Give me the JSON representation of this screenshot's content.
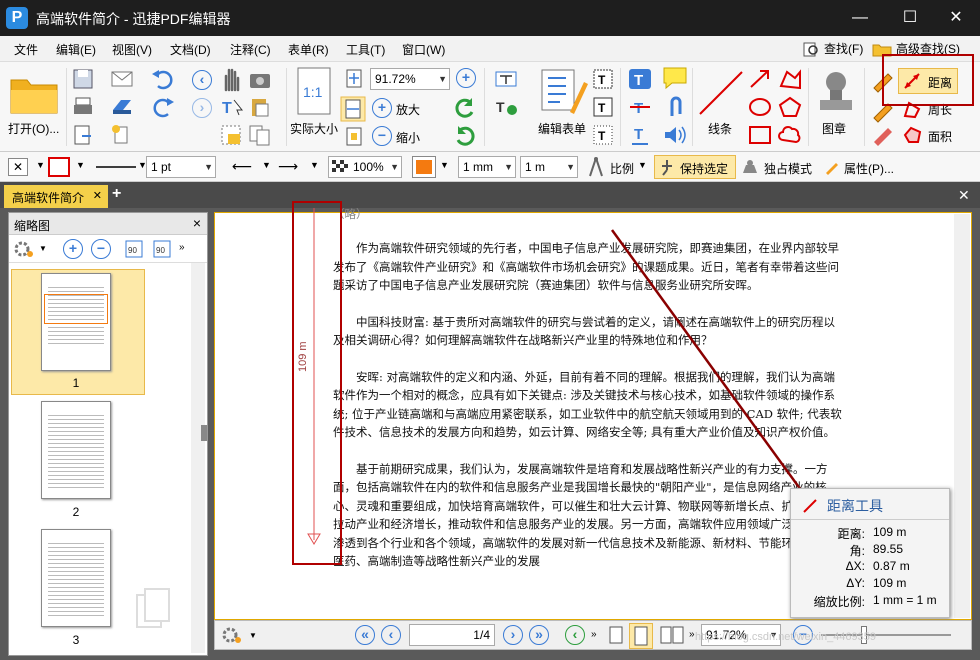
{
  "window": {
    "title": "高端软件简介 - 迅捷PDF编辑器",
    "app_icon": "P",
    "min": "—",
    "max": "☐",
    "close": "✕"
  },
  "menu": {
    "items": [
      "文件",
      "编辑(E)",
      "视图(V)",
      "文档(D)",
      "注释(C)",
      "表单(R)",
      "工具(T)",
      "窗口(W)"
    ],
    "find": "查找(F)",
    "adv_find": "高级查找(S)"
  },
  "ribbon": {
    "open": "打开(O)...",
    "zoom": "91.72%",
    "zoom_in": "放大",
    "zoom_out": "缩小",
    "actual_size": "实际大小",
    "actual_icon": "1:1",
    "edit_form": "编辑表单",
    "lines": "线条",
    "stamp": "图章",
    "distance": "距离",
    "perimeter": "周长",
    "area": "面积",
    "text_t": "T"
  },
  "props": {
    "line_width": "1 pt",
    "opacity": "100%",
    "w1": "1 mm",
    "w2": "1 m",
    "scale": "比例",
    "keep_selected": "保持选定",
    "exclusive": "独占模式",
    "properties": "属性(P)..."
  },
  "tabs": {
    "doc": "高端软件简介",
    "add": "+",
    "close": "✕"
  },
  "thumbs": {
    "title": "缩略图",
    "close": "×",
    "pages": [
      "1",
      "2",
      "3"
    ],
    "rot_l": "90",
    "rot_r": "90"
  },
  "doc": {
    "top_fragment": "（略）",
    "paragraphs": [
      "作为高端软件研究领域的先行者，中国电子信息产业发展研究院，即赛迪集团，在业界内部较早发布了《高端软件产业研究》和《高端软件市场机会研究》的课题成果。近日，笔者有幸带着这些问题采访了中国电子信息产业发展研究院（赛迪集团）软件与信息服务业研究所安晖。",
      "中国科技财富: 基于贵所对高端软件的研究与尝试着的定义，请阐述在高端软件上的研究历程以及相关调研心得？如何理解高端软件在战略新兴产业里的特殊地位和作用？",
      "安晖: 对高端软件的定义和内涵、外延，目前有着不同的理解。根据我们的理解，我们认为高端软件作为一个相对的概念，应具有如下关键点: 涉及关键技术与核心技术，如基础软件领域的操作系统; 位于产业链高端和与高端应用紧密联系，如工业软件中的航空航天领域用到的 CAD 软件; 代表软件技术、信息技术的发展方向和趋势，如云计算、网络安全等; 具有重大产业价值及知识产权价值。",
      "基于前期研究成果，我们认为，发展高端软件是培育和发展战略性新兴产业的有力支撑。一方面，包括高端软件在内的软件和信息服务产业是我国增长最快的\"朝阳产业\"，是信息网络产业的核心、灵魂和重要组成，加快培育高端软件，可以催生和壮大云计算、物联网等新增长点、扩大内需、拉动产业和经济增长，推动软件和信息服务产业的发展。另一方面，高端软件应用领域广泛，已深入渗透到各个行业和各个领域，高端软件的发展对新一代信息技术及新能源、新材料、节能环保、生物医药、高端制造等战略性新兴产业的发展"
    ],
    "measure_label": "109 m"
  },
  "tooltip": {
    "title": "距离工具",
    "rows": [
      [
        "距离:",
        "109 m"
      ],
      [
        "角:",
        "89.55"
      ],
      [
        "ΔX:",
        "0.87 m"
      ],
      [
        "ΔY:",
        "109 m"
      ],
      [
        "缩放比例:",
        "1 mm = 1 m"
      ]
    ]
  },
  "status": {
    "page": "1",
    "of": "/4",
    "zoom": "91.72%",
    "watermark": "https://blog.csdn.net/weixin_4469359"
  },
  "colors": {
    "accent": "#f4d04a",
    "measure_red": "#b00000",
    "blue": "#3a7bd5"
  }
}
